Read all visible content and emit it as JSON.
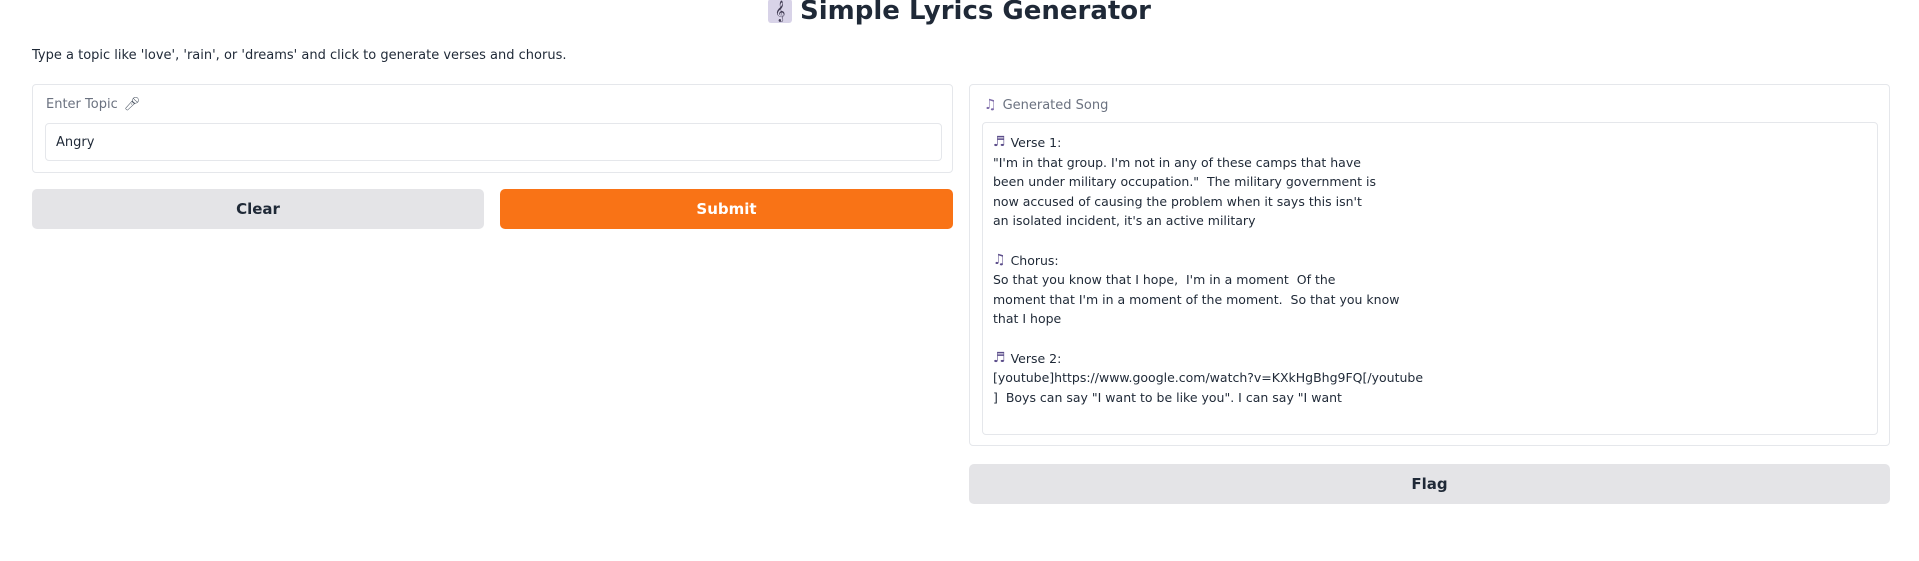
{
  "header": {
    "title": "Simple Lyrics Generator",
    "title_icon": "treble-clef-icon"
  },
  "description": "Type a topic like 'love', 'rain', or 'dreams' and click to generate verses and chorus.",
  "input": {
    "label": "Enter Topic",
    "label_icon": "microphone-icon",
    "value": "Angry"
  },
  "buttons": {
    "clear": "Clear",
    "submit": "Submit",
    "flag": "Flag"
  },
  "output": {
    "label": "Generated Song",
    "label_icon": "music-notes-icon",
    "sections": [
      {
        "heading": "Verse 1:",
        "icon": "music-note-icon",
        "lines": [
          "\"I'm in that group. I'm not in any of these camps that have",
          "been under military occupation.\"  The military government is",
          "now accused of causing the problem when it says this isn't",
          "an isolated incident, it's an active military"
        ]
      },
      {
        "heading": "Chorus:",
        "icon": "music-notes-icon",
        "lines": [
          "So that you know that I hope,  I'm in a moment  Of the",
          "moment that I'm in a moment of the moment.  So that you know",
          "that I hope"
        ]
      },
      {
        "heading": "Verse 2:",
        "icon": "music-note-icon",
        "lines": [
          "[youtube]https://www.google.com/watch?v=KXkHgBhg9FQ[/youtube",
          "]  Boys can say \"I want to be like you\". I can say \"I want"
        ]
      }
    ]
  },
  "colors": {
    "accent": "#f97316",
    "button_secondary": "#e4e4e7",
    "border": "#e5e7eb"
  }
}
